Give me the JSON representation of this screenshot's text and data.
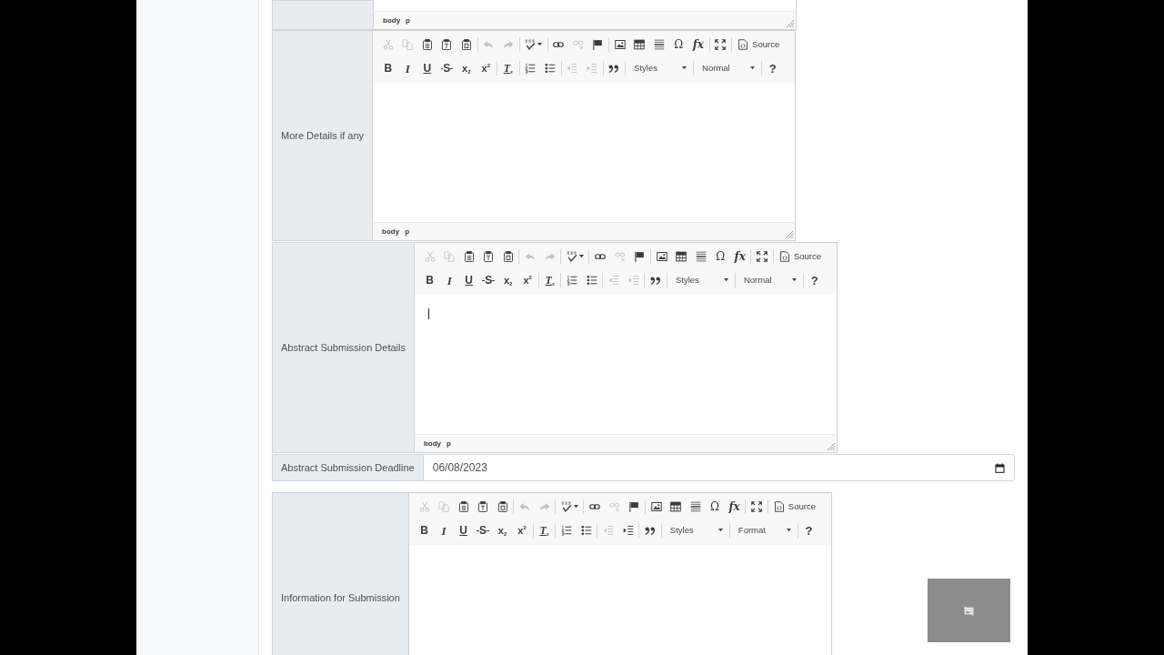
{
  "form_rows": [
    {
      "kind": "editor_tail",
      "focused": false,
      "path": [
        "body",
        "p"
      ]
    },
    {
      "kind": "editor",
      "label": "More Details if any",
      "focused": false,
      "toolbar": [
        [
          [
            {
              "kind": "cut",
              "disabled": true
            },
            {
              "kind": "copy",
              "disabled": true
            },
            {
              "kind": "paste",
              "disabled": false
            },
            {
              "kind": "paste_text",
              "disabled": false
            },
            {
              "kind": "paste_word",
              "disabled": false
            }
          ],
          [
            {
              "kind": "undo",
              "disabled": true
            },
            {
              "kind": "redo",
              "disabled": true
            }
          ],
          [
            {
              "kind": "spellcheck",
              "disabled": false
            }
          ],
          [
            {
              "kind": "link",
              "disabled": false
            },
            {
              "kind": "unlink",
              "disabled": true
            },
            {
              "kind": "anchor",
              "disabled": false
            }
          ],
          [
            {
              "kind": "image",
              "disabled": false
            },
            {
              "kind": "table",
              "disabled": false
            },
            {
              "kind": "hline",
              "disabled": false
            },
            {
              "kind": "glyph",
              "label": "Ω",
              "disabled": false
            },
            {
              "kind": "formula",
              "label": "fx",
              "disabled": false
            }
          ],
          [
            {
              "kind": "maximize",
              "disabled": false
            }
          ],
          [
            {
              "kind": "source",
              "label": "Source",
              "disabled": false
            }
          ]
        ],
        [
          [
            {
              "kind": "bold",
              "label": "B",
              "disabled": false
            },
            {
              "kind": "italic",
              "label": "I",
              "disabled": false
            },
            {
              "kind": "underline",
              "label": "U",
              "disabled": false
            },
            {
              "kind": "strike",
              "label": "S",
              "disabled": false
            },
            {
              "kind": "subscript",
              "label": "x$_{2}$",
              "disabled": false
            },
            {
              "kind": "superscript",
              "label": "x$^{2}$",
              "disabled": false
            }
          ],
          [
            {
              "kind": "remove_format",
              "label": "T$_{x}$",
              "disabled": false
            }
          ],
          [
            {
              "kind": "numbered_list",
              "disabled": false
            },
            {
              "kind": "bulleted_list",
              "disabled": false
            }
          ],
          [
            {
              "kind": "outdent",
              "disabled": true
            },
            {
              "kind": "indent",
              "disabled": true
            }
          ],
          [
            {
              "kind": "blockquote",
              "disabled": false
            }
          ],
          [
            {
              "kind": "combo",
              "label": "Styles",
              "disabled": false
            }
          ],
          [
            {
              "kind": "combo",
              "label": "Normal",
              "disabled": false
            }
          ],
          [
            {
              "kind": "help",
              "label": "?",
              "disabled": false
            }
          ]
        ]
      ],
      "path": [
        "body",
        "p"
      ]
    },
    {
      "kind": "editor",
      "label": "Abstract Submission Details",
      "focused": true,
      "toolbar": [
        [
          [
            {
              "kind": "cut",
              "disabled": true
            },
            {
              "kind": "copy",
              "disabled": true
            },
            {
              "kind": "paste",
              "disabled": false
            },
            {
              "kind": "paste_text",
              "disabled": false
            },
            {
              "kind": "paste_word",
              "disabled": false
            }
          ],
          [
            {
              "kind": "undo",
              "disabled": true
            },
            {
              "kind": "redo",
              "disabled": true
            }
          ],
          [
            {
              "kind": "spellcheck",
              "disabled": false
            }
          ],
          [
            {
              "kind": "link",
              "disabled": false
            },
            {
              "kind": "unlink",
              "disabled": true
            },
            {
              "kind": "anchor",
              "disabled": false
            }
          ],
          [
            {
              "kind": "image",
              "disabled": false
            },
            {
              "kind": "table",
              "disabled": false
            },
            {
              "kind": "hline",
              "disabled": false
            },
            {
              "kind": "glyph",
              "label": "Ω",
              "disabled": false
            },
            {
              "kind": "formula",
              "label": "fx",
              "disabled": false
            }
          ],
          [
            {
              "kind": "maximize",
              "disabled": false
            }
          ],
          [
            {
              "kind": "source",
              "label": "Source",
              "disabled": false
            }
          ]
        ],
        [
          [
            {
              "kind": "bold",
              "label": "B",
              "disabled": false
            },
            {
              "kind": "italic",
              "label": "I",
              "disabled": false
            },
            {
              "kind": "underline",
              "label": "U",
              "disabled": false
            },
            {
              "kind": "strike",
              "label": "S",
              "disabled": false
            },
            {
              "kind": "subscript",
              "label": "x$_{2}$",
              "disabled": false
            },
            {
              "kind": "superscript",
              "label": "x$^{2}$",
              "disabled": false
            }
          ],
          [
            {
              "kind": "remove_format",
              "label": "T$_{x}$",
              "disabled": false
            }
          ],
          [
            {
              "kind": "numbered_list",
              "disabled": false
            },
            {
              "kind": "bulleted_list",
              "disabled": false
            }
          ],
          [
            {
              "kind": "outdent",
              "disabled": true
            },
            {
              "kind": "indent",
              "disabled": true
            }
          ],
          [
            {
              "kind": "blockquote",
              "disabled": false
            }
          ],
          [
            {
              "kind": "combo",
              "label": "Styles",
              "disabled": false
            }
          ],
          [
            {
              "kind": "combo",
              "label": "Normal",
              "disabled": false
            }
          ],
          [
            {
              "kind": "help",
              "label": "?",
              "disabled": false
            }
          ]
        ]
      ],
      "path": [
        "body",
        "p"
      ]
    },
    {
      "kind": "date",
      "label": "Abstract Submission Deadline",
      "value": "06/08/2023"
    },
    {
      "kind": "editor",
      "label": "Information for Submission",
      "focused": false,
      "toolbar": [
        [
          [
            {
              "kind": "cut",
              "disabled": true
            },
            {
              "kind": "copy",
              "disabled": true
            },
            {
              "kind": "paste",
              "disabled": false
            },
            {
              "kind": "paste_text",
              "disabled": false
            },
            {
              "kind": "paste_word",
              "disabled": false
            }
          ],
          [
            {
              "kind": "undo",
              "disabled": true
            },
            {
              "kind": "redo",
              "disabled": true
            }
          ],
          [
            {
              "kind": "spellcheck",
              "disabled": false
            }
          ],
          [
            {
              "kind": "link",
              "disabled": false
            },
            {
              "kind": "unlink",
              "disabled": true
            },
            {
              "kind": "anchor",
              "disabled": false
            }
          ],
          [
            {
              "kind": "image",
              "disabled": false
            },
            {
              "kind": "table",
              "disabled": false
            },
            {
              "kind": "hline",
              "disabled": false
            },
            {
              "kind": "glyph",
              "label": "Ω",
              "disabled": false
            },
            {
              "kind": "formula",
              "label": "fx",
              "disabled": false
            }
          ],
          [
            {
              "kind": "maximize",
              "disabled": false
            }
          ],
          [
            {
              "kind": "source",
              "label": "Source",
              "disabled": false
            }
          ]
        ],
        [
          [
            {
              "kind": "bold",
              "label": "B",
              "disabled": false
            },
            {
              "kind": "italic",
              "label": "I",
              "disabled": false
            },
            {
              "kind": "underline",
              "label": "U",
              "disabled": false
            },
            {
              "kind": "strike",
              "label": "S",
              "disabled": false
            },
            {
              "kind": "subscript",
              "label": "x$_{2}$",
              "disabled": false
            },
            {
              "kind": "superscript",
              "label": "x$^{2}$",
              "disabled": false
            }
          ],
          [
            {
              "kind": "remove_format",
              "label": "T$_{x}$",
              "disabled": false
            }
          ],
          [
            {
              "kind": "numbered_list",
              "disabled": false
            },
            {
              "kind": "bulleted_list",
              "disabled": false
            }
          ],
          [
            {
              "kind": "outdent",
              "disabled": true
            },
            {
              "kind": "indent",
              "disabled": false
            }
          ],
          [
            {
              "kind": "blockquote",
              "disabled": false
            }
          ],
          [
            {
              "kind": "combo",
              "label": "Styles",
              "disabled": false
            }
          ],
          [
            {
              "kind": "combo",
              "label": "Format",
              "disabled": false
            }
          ],
          [
            {
              "kind": "help",
              "label": "?",
              "disabled": false
            }
          ]
        ]
      ]
    }
  ]
}
